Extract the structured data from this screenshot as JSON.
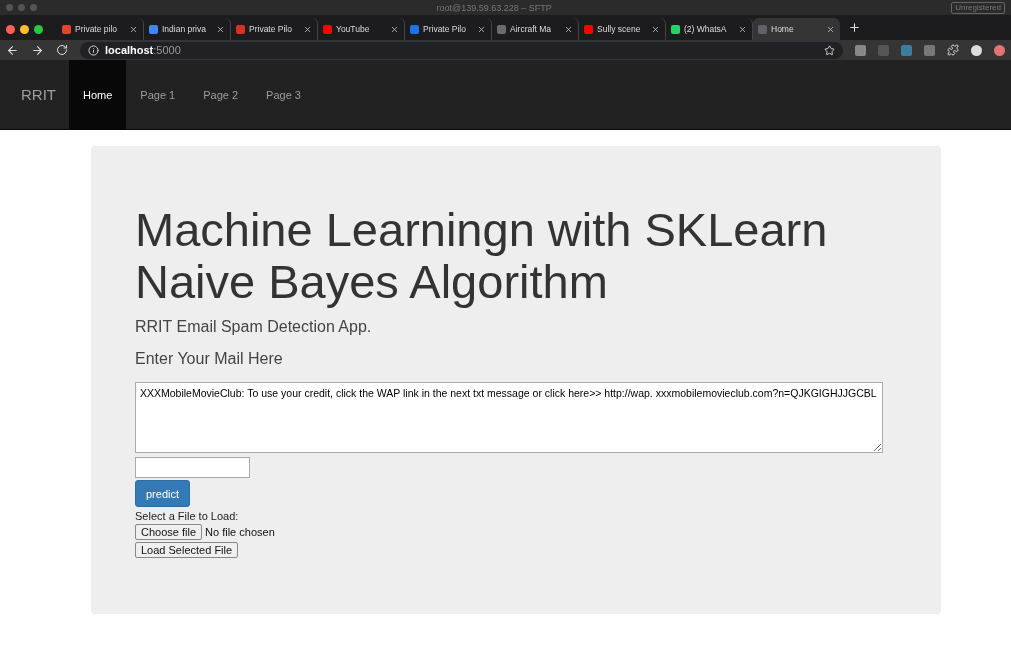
{
  "window": {
    "title": "root@139.59.63.228 – SFTP",
    "badge": "Unregistered"
  },
  "tabs": [
    {
      "label": "Private pilo",
      "color": "#e0452e",
      "selected": false
    },
    {
      "label": "Indian priva",
      "color": "#4285f4",
      "selected": false
    },
    {
      "label": "Private Pilo",
      "color": "#d93025",
      "selected": false
    },
    {
      "label": "YouTube",
      "color": "#ff0000",
      "selected": false
    },
    {
      "label": "Private Pilo",
      "color": "#1a73e8",
      "selected": false
    },
    {
      "label": "Aircraft Ma",
      "color": "#6b6b6b",
      "selected": false
    },
    {
      "label": "Sully scene",
      "color": "#ff0000",
      "selected": false
    },
    {
      "label": "(2) WhatsA",
      "color": "#25d366",
      "selected": false
    },
    {
      "label": "Home",
      "color": "#5f6368",
      "selected": true
    }
  ],
  "address": {
    "host": "localhost",
    "port": ":5000"
  },
  "navbar": {
    "brand": "RRIT",
    "items": [
      {
        "label": "Home",
        "selected": true
      },
      {
        "label": "Page 1",
        "selected": false
      },
      {
        "label": "Page 2",
        "selected": false
      },
      {
        "label": "Page 3",
        "selected": false
      }
    ]
  },
  "hero": {
    "title_lines": [
      "Machine Learningn with SKLearn",
      "Naive Bayes Algorithm"
    ],
    "subtitle": "RRIT Email Spam Detection App.",
    "prompt": "Enter Your Mail Here"
  },
  "form": {
    "message": "XXXMobileMovieClub: To use your credit, click the WAP link in the next txt message or click here>> http://wap. xxxmobilemovieclub.com?n=QJKGIGHJJGCBL",
    "predict_button": "predict",
    "file_label": "Select a File to Load:",
    "choose_button": "Choose file",
    "file_status": "No file chosen",
    "load_button": "Load Selected File"
  }
}
